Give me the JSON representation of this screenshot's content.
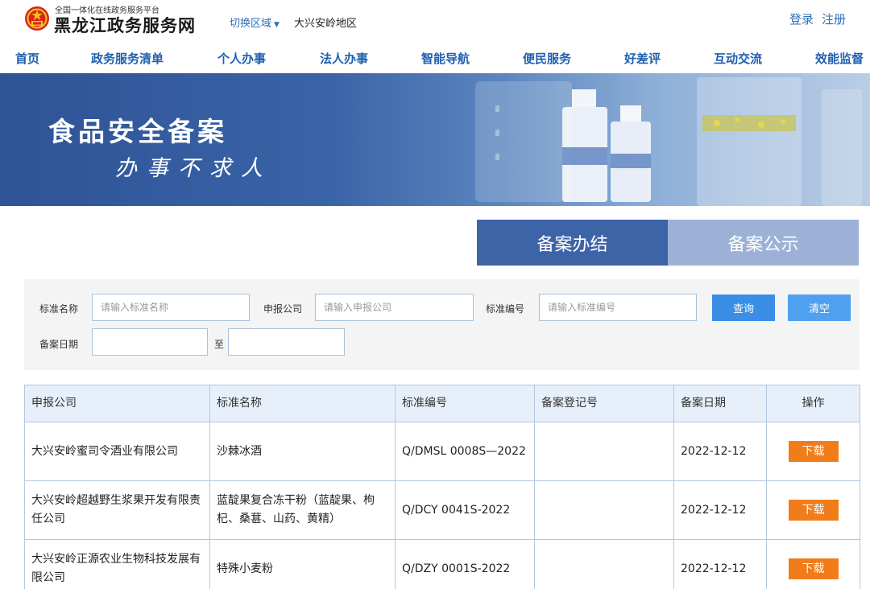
{
  "header": {
    "platform_subtitle": "全国一体化在线政务服务平台",
    "site_title": "黑龙江政务服务网",
    "region_switch_label": "切换区域",
    "region_name": "大兴安岭地区",
    "login_label": "登录",
    "register_label": "注册"
  },
  "nav": {
    "items": [
      {
        "label": "首页"
      },
      {
        "label": "政务服务清单"
      },
      {
        "label": "个人办事"
      },
      {
        "label": "法人办事"
      },
      {
        "label": "智能导航"
      },
      {
        "label": "便民服务"
      },
      {
        "label": "好差评"
      },
      {
        "label": "互动交流"
      },
      {
        "label": "效能监督"
      }
    ]
  },
  "banner": {
    "title": "食品安全备案",
    "slogan": "办事不求人"
  },
  "tabs": {
    "done_label": "备案办结",
    "public_label": "备案公示",
    "active": "备案办结"
  },
  "filter": {
    "standard_name_label": "标准名称",
    "standard_name_placeholder": "请输入标准名称",
    "company_label": "申报公司",
    "company_placeholder": "请输入申报公司",
    "standard_no_label": "标准编号",
    "standard_no_placeholder": "请输入标准编号",
    "date_label": "备案日期",
    "date_to_label": "至",
    "search_button": "查询",
    "clear_button": "清空"
  },
  "table": {
    "headers": [
      "申报公司",
      "标准名称",
      "标准编号",
      "备案登记号",
      "备案日期",
      "操作"
    ],
    "rows": [
      {
        "company": "大兴安岭蜜司令酒业有限公司",
        "name": "沙棘冰酒",
        "number": "Q/DMSL 0008S—2022",
        "reg_no": "",
        "date": "2022-12-12",
        "action": "下载"
      },
      {
        "company": "大兴安岭超越野生浆果开发有限责任公司",
        "name": "蓝靛果复合冻干粉（蓝靛果、枸杞、桑葚、山药、黄精）",
        "number": "Q/DCY 0041S-2022",
        "reg_no": "",
        "date": "2022-12-12",
        "action": "下载"
      },
      {
        "company": "大兴安岭正源农业生物科技发展有限公司",
        "name": "特殊小麦粉",
        "number": "Q/DZY 0001S-2022",
        "reg_no": "",
        "date": "2022-12-12",
        "action": "下载"
      }
    ]
  },
  "colors": {
    "brand_blue": "#1f5fae",
    "tab_active": "#3e64a8",
    "tab_inactive": "#9db1d6",
    "download_orange": "#f07d1a",
    "search_blue": "#3a8ee6"
  },
  "icons": {
    "emblem": "national-emblem-icon",
    "region_caret": "caret-down-icon"
  }
}
